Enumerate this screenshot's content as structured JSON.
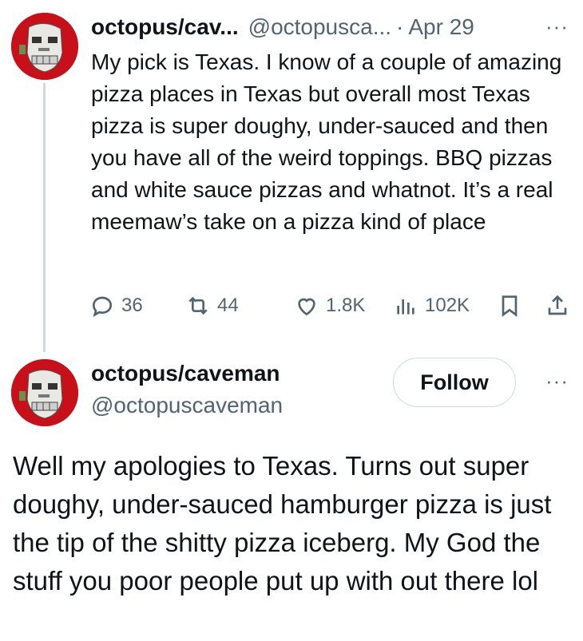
{
  "tweet1": {
    "display_name": "octopus/cav...",
    "handle": "@octopusca...",
    "separator": "·",
    "date": "Apr 29",
    "more_label": "···",
    "text": "My pick is Texas. I know of a couple of amazing pizza places in Texas but overall most Texas pizza is super doughy, under-sauced and then you have all of the weird toppings. BBQ pizzas and white sauce pizzas and whatnot. It’s a real meemaw’s take on a pizza kind of place",
    "replies": "36",
    "reposts": "44",
    "likes": "1.8K",
    "views": "102K"
  },
  "tweet2": {
    "display_name": "octopus/caveman",
    "handle": "@octopuscaveman",
    "follow_label": "Follow",
    "more_label": "···",
    "text": "Well my apologies to Texas. Turns out super doughy, under-sauced hamburger pizza is just the tip of the shitty pizza iceberg. My God the stuff you poor people put up with out there lol"
  },
  "colors": {
    "text": "#0f1419",
    "secondary": "#536471",
    "thread_line": "#cfd9de",
    "avatar_bg": "#c8101b"
  }
}
